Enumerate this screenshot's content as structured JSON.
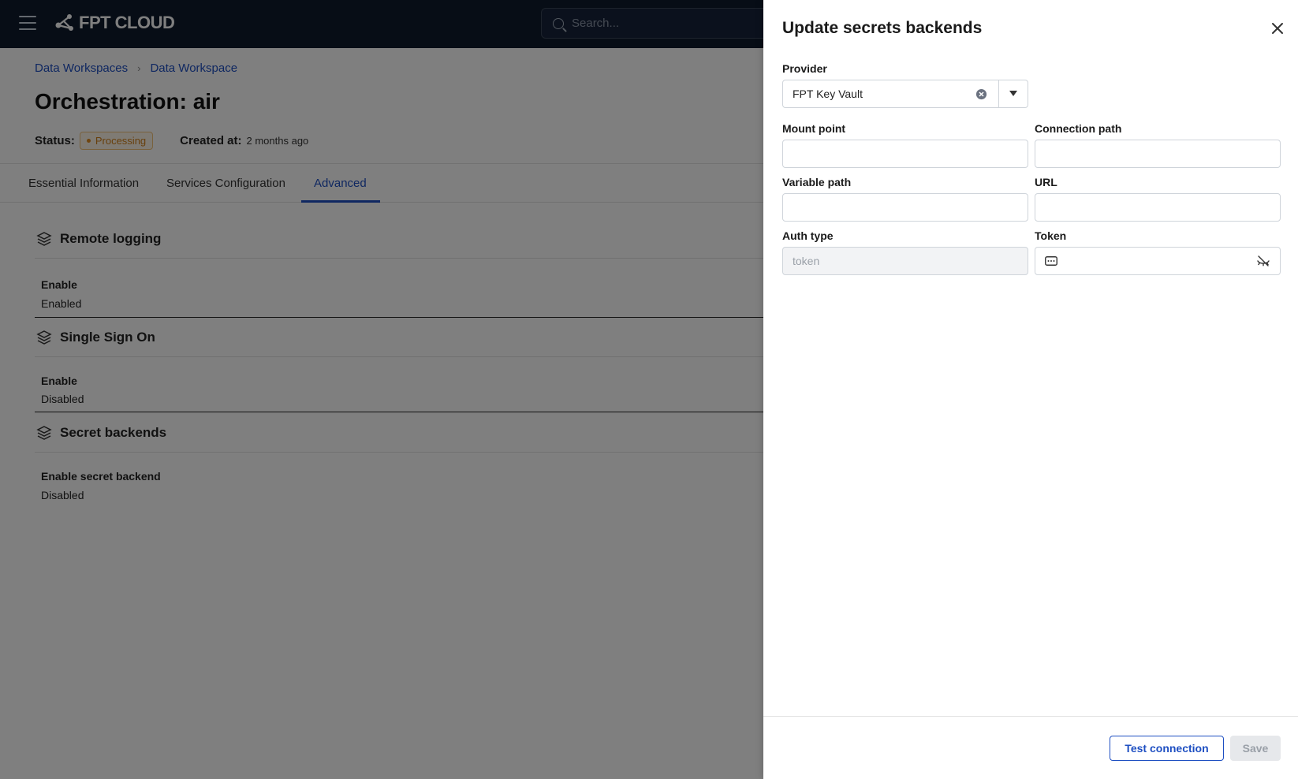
{
  "topbar": {
    "logo_text": "FPT CLOUD",
    "search_placeholder": "Search..."
  },
  "breadcrumb": [
    "Data Workspaces",
    "Data Workspace"
  ],
  "page": {
    "title": "Orchestration: air",
    "status_label": "Status:",
    "status_value": "Processing",
    "created_label": "Created at:",
    "created_value": "2 months ago"
  },
  "tabs": [
    "Essential Information",
    "Services Configuration",
    "Advanced"
  ],
  "active_tab": "Advanced",
  "sections": [
    {
      "title": "Remote logging",
      "field_label": "Enable",
      "field_value": "Enabled"
    },
    {
      "title": "Single Sign On",
      "field_label": "Enable",
      "field_value": "Disabled"
    },
    {
      "title": "Secret backends",
      "field_label": "Enable secret backend",
      "field_value": "Disabled"
    }
  ],
  "drawer": {
    "title": "Update secrets backends",
    "provider_label": "Provider",
    "provider_value": "FPT Key Vault",
    "mount_point_label": "Mount point",
    "mount_point_value": "",
    "connection_path_label": "Connection path",
    "connection_path_value": "",
    "variable_path_label": "Variable path",
    "variable_path_value": "",
    "url_label": "URL",
    "url_value": "",
    "auth_type_label": "Auth type",
    "auth_type_placeholder": "token",
    "token_label": "Token",
    "token_value": "",
    "test_button": "Test connection",
    "save_button": "Save"
  },
  "colors": {
    "topbar_bg": "#0f1b2d",
    "link": "#1e4fc2",
    "status_accent": "#e08a1e"
  }
}
